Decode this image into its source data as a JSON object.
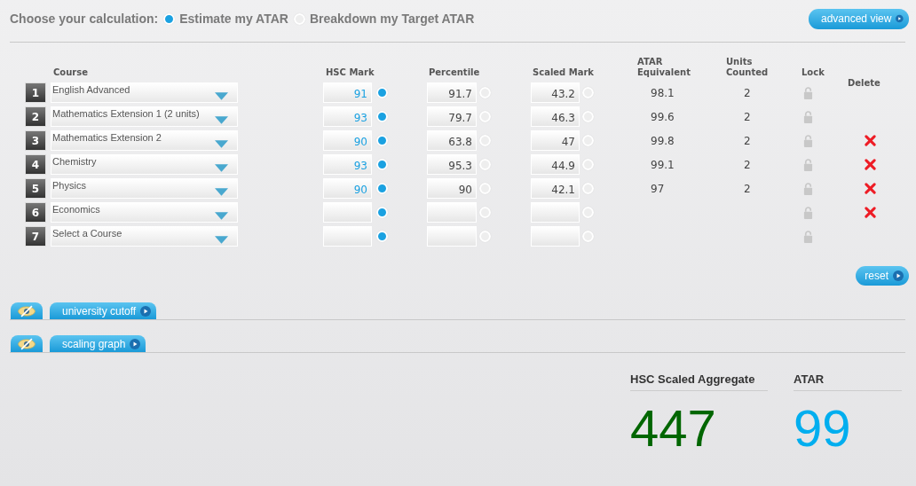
{
  "calculation": {
    "label": "Choose your calculation:",
    "options": [
      {
        "label": "Estimate my ATAR",
        "selected": true
      },
      {
        "label": "Breakdown my Target ATAR",
        "selected": false
      }
    ]
  },
  "advanced_button": "advanced view",
  "table": {
    "columns": [
      "Course",
      "HSC Mark",
      "Percentile",
      "Scaled Mark",
      "ATAR Equivalent",
      "Units Counted",
      "Lock",
      "Delete"
    ],
    "rows": [
      {
        "number": "1",
        "course": "English Advanced",
        "hsc_mark": "91",
        "percentile": "91.7",
        "scaled_mark": "43.2",
        "atar_equivalent": "98.1",
        "units_counted": "2",
        "hsc_mark_selected": true,
        "percentile_selected": false,
        "scaled_mark_selected": false,
        "deletable": false
      },
      {
        "number": "2",
        "course": "Mathematics Extension 1 (2 units)",
        "hsc_mark": "93",
        "percentile": "79.7",
        "scaled_mark": "46.3",
        "atar_equivalent": "99.6",
        "units_counted": "2",
        "hsc_mark_selected": true,
        "percentile_selected": false,
        "scaled_mark_selected": false,
        "deletable": false
      },
      {
        "number": "3",
        "course": "Mathematics Extension 2",
        "hsc_mark": "90",
        "percentile": "63.8",
        "scaled_mark": "47",
        "atar_equivalent": "99.8",
        "units_counted": "2",
        "hsc_mark_selected": true,
        "percentile_selected": false,
        "scaled_mark_selected": false,
        "deletable": true
      },
      {
        "number": "4",
        "course": "Chemistry",
        "hsc_mark": "93",
        "percentile": "95.3",
        "scaled_mark": "44.9",
        "atar_equivalent": "99.1",
        "units_counted": "2",
        "hsc_mark_selected": true,
        "percentile_selected": false,
        "scaled_mark_selected": false,
        "deletable": true
      },
      {
        "number": "5",
        "course": "Physics",
        "hsc_mark": "90",
        "percentile": "90",
        "scaled_mark": "42.1",
        "atar_equivalent": "97",
        "units_counted": "2",
        "hsc_mark_selected": true,
        "percentile_selected": false,
        "scaled_mark_selected": false,
        "deletable": true
      },
      {
        "number": "6",
        "course": "Economics",
        "hsc_mark_selected": true,
        "percentile_selected": false,
        "scaled_mark_selected": false,
        "deletable": true
      },
      {
        "number": "7",
        "course": "Select a Course",
        "hsc_mark_selected": true,
        "percentile_selected": false,
        "scaled_mark_selected": false,
        "deletable": false
      }
    ]
  },
  "reset_button": "reset",
  "panels": [
    {
      "label": "university cutoff",
      "visible": false
    },
    {
      "label": "scaling graph",
      "visible": false
    }
  ],
  "results": [
    {
      "label": "HSC Scaled Aggregate",
      "value": "447",
      "color": "#006600"
    },
    {
      "label": "ATAR",
      "value": "99",
      "color": "#00aeef"
    }
  ]
}
